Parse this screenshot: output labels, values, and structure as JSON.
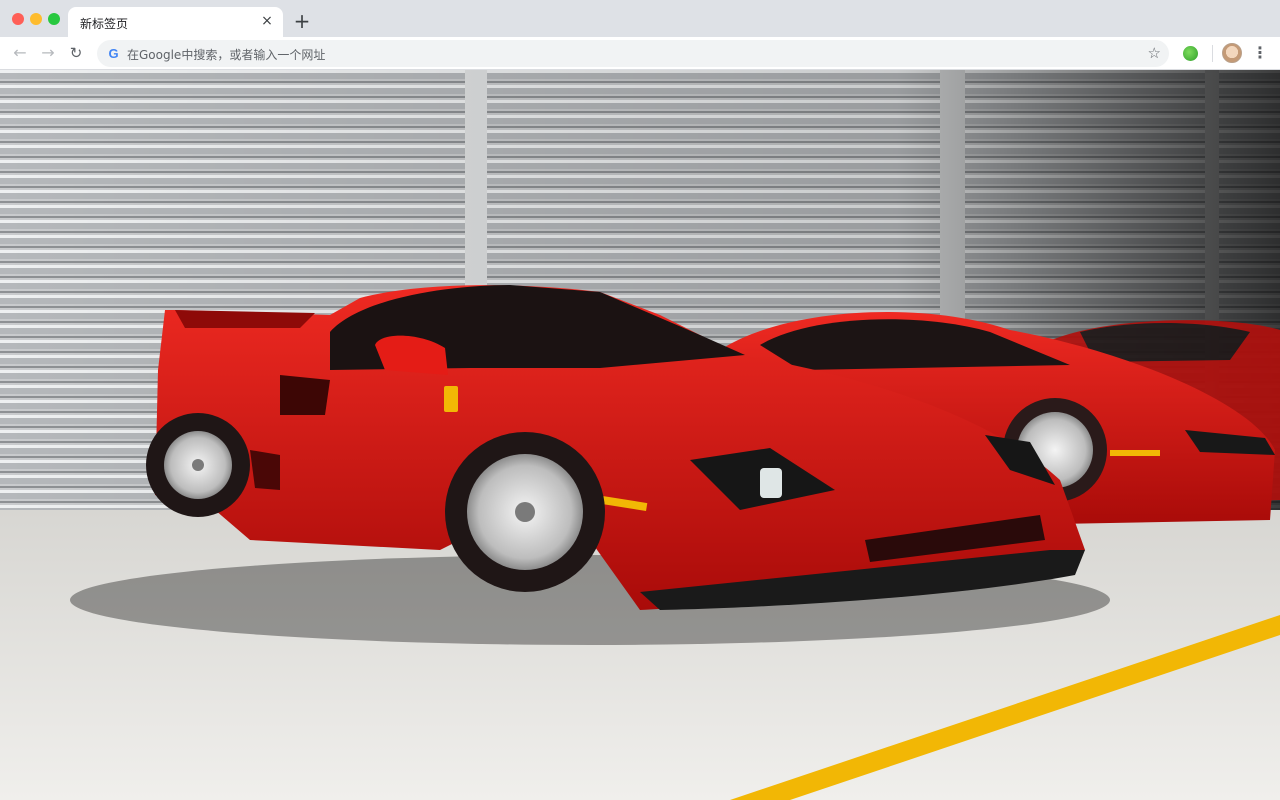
{
  "tab": {
    "title": "新标签页",
    "close_glyph": "×"
  },
  "newtab": {
    "glyph": "+"
  },
  "nav": {
    "back": "←",
    "forward": "→",
    "reload": "↻"
  },
  "omnibox": {
    "placeholder": "在Google中搜索，或者输入一个网址",
    "g_letter": "G"
  },
  "icons": {
    "bookmark_star": "☆",
    "menu_dots": "⋮",
    "extension": "extension-icon",
    "avatar": "avatar-icon"
  },
  "colors": {
    "tabstrip": "#dee1e6",
    "ferrari_red": "#d3120f",
    "floor_line": "#f2b705"
  }
}
